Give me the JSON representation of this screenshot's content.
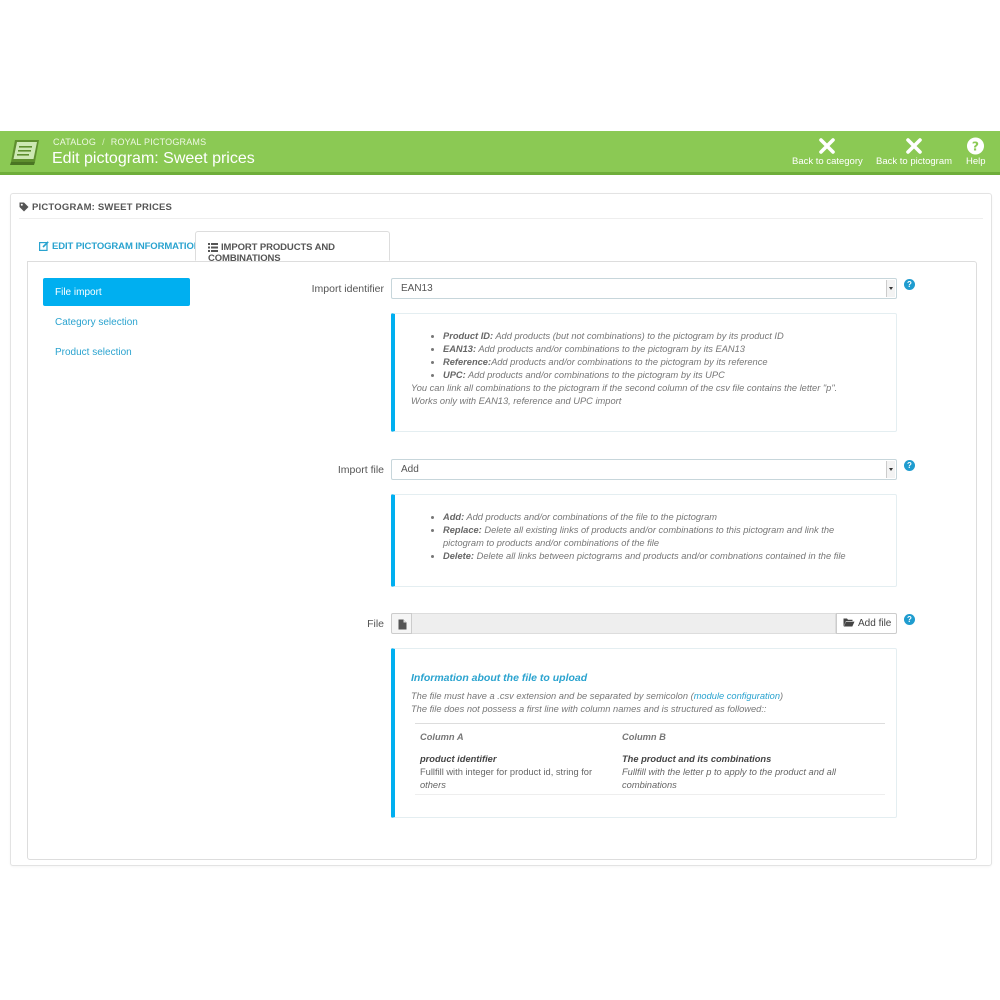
{
  "header": {
    "breadcrumb": [
      "CATALOG",
      "ROYAL PICTOGRAMS"
    ],
    "breadcrumb_sep": "/",
    "title": "Edit pictogram: Sweet prices",
    "buttons": [
      {
        "label": "Back to category",
        "icon": "close-icon"
      },
      {
        "label": "Back to pictogram",
        "icon": "close-icon"
      },
      {
        "label": "Help",
        "icon": "help-icon"
      }
    ],
    "colors": {
      "bar": "#8bc954",
      "bar_border": "#6fae3a"
    }
  },
  "panel": {
    "heading": "PICTOGRAM: SWEET PRICES",
    "tabs": [
      {
        "label": "EDIT PICTOGRAM INFORMATIONS",
        "icon": "edit-icon",
        "active": false
      },
      {
        "label": "IMPORT PRODUCTS AND COMBINATIONS",
        "icon": "list-icon",
        "active": true
      }
    ]
  },
  "sidebar": {
    "items": [
      {
        "label": "File import",
        "active": true
      },
      {
        "label": "Category selection",
        "active": false
      },
      {
        "label": "Product selection",
        "active": false
      }
    ]
  },
  "form": {
    "import_identifier": {
      "label": "Import identifier",
      "value": "EAN13",
      "help": [
        {
          "term": "Product ID:",
          "text": " Add products (but not combinations) to the pictogram by its product ID"
        },
        {
          "term": "EAN13:",
          "text": " Add products and/or combinations to the pictogram by its EAN13"
        },
        {
          "term": "Reference:",
          "text": "Add products and/or combinations to the pictogram by its reference"
        },
        {
          "term": "UPC:",
          "text": " Add products and/or combinations to the pictogram by its UPC"
        }
      ],
      "note_line1": "You can link all combinations to the pictogram if the second column of the csv file contains the letter \"p\".",
      "note_line2": "Works only with EAN13, reference and UPC import"
    },
    "import_file": {
      "label": "Import file",
      "value": "Add",
      "help": [
        {
          "term": "Add:",
          "text": " Add products and/or combinations of the file to the pictogram"
        },
        {
          "term": "Replace:",
          "text": " Delete all existing links of products and/or combinations to this pictogram and link the"
        },
        {
          "term": "",
          "text": "pictogram to products and/or combinations of the file"
        },
        {
          "term": "Delete:",
          "text": " Delete all links between pictograms and products and/or combnations contained in the file"
        }
      ]
    },
    "file": {
      "label": "File",
      "button": "Add file"
    },
    "file_info": {
      "title": "Information about the file to upload",
      "line1_before": "The file must have a .csv extension and be separated by semicolon (",
      "line1_link": "module configuration",
      "line1_after": ")",
      "line2": "The file does not possess a first line with column names and is structured as followed::",
      "columns": [
        {
          "header": "Column A",
          "title": "product identifier",
          "desc1": "Fullfill with integer for product id, string for",
          "desc2": "others"
        },
        {
          "header": "Column B",
          "title": "The product and its combinations",
          "desc1": "Fullfill with the letter p to apply to the product and all",
          "desc2": "combinations"
        }
      ]
    }
  },
  "colors": {
    "accent": "#00aff0",
    "link": "#2aa3cf"
  }
}
